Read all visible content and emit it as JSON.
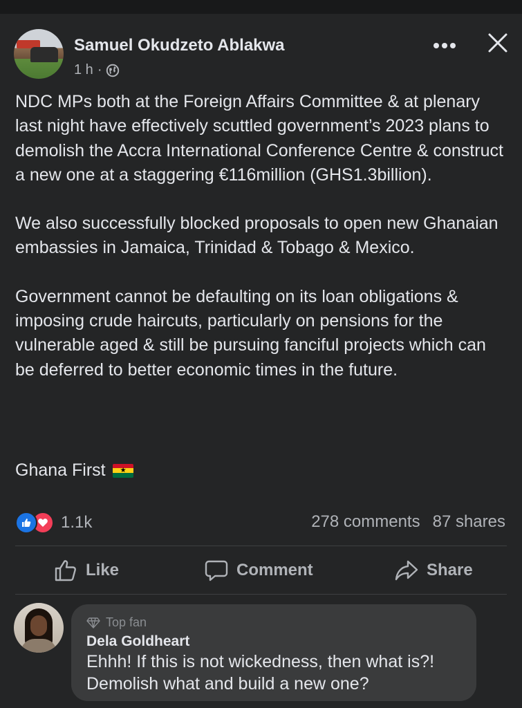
{
  "post": {
    "author": "Samuel Okudzeto Ablakwa",
    "time": "1 h",
    "separator": "·",
    "paragraphs": [
      "NDC MPs both at the Foreign Affairs Committee & at plenary last night have effectively scuttled government’s 2023 plans to demolish the Accra International Conference Centre & construct a new one at a staggering €116million (GHS1.3billion).",
      "We also successfully blocked proposals to open new Ghanaian embassies in Jamaica, Trinidad & Tobago & Mexico.",
      "Government cannot be defaulting on its loan obligations & imposing crude haircuts, particularly on pensions for the vulnerable aged & still be pursuing fanciful projects which can be deferred to better economic times in the future."
    ],
    "closing": "Ghana First",
    "icons": {
      "more": "more-options-icon",
      "close": "close-icon",
      "privacy": "globe-icon",
      "flag": "ghana-flag-emoji"
    }
  },
  "stats": {
    "reactions": "1.1k",
    "comments": "278 comments",
    "shares": "87 shares"
  },
  "actions": {
    "like": "Like",
    "comment": "Comment",
    "share": "Share"
  },
  "comment": {
    "badge": "Top fan",
    "author": "Dela Goldheart",
    "text": "Ehhh! If this is not wickedness, then what is?! Demolish what and build a new one?"
  },
  "colors": {
    "background": "#242526",
    "bubble": "#3a3b3c",
    "text": "#e4e6eb",
    "secondary": "#b0b3b8",
    "like_blue": "#1b74e4",
    "love_red": "#f33e58"
  }
}
